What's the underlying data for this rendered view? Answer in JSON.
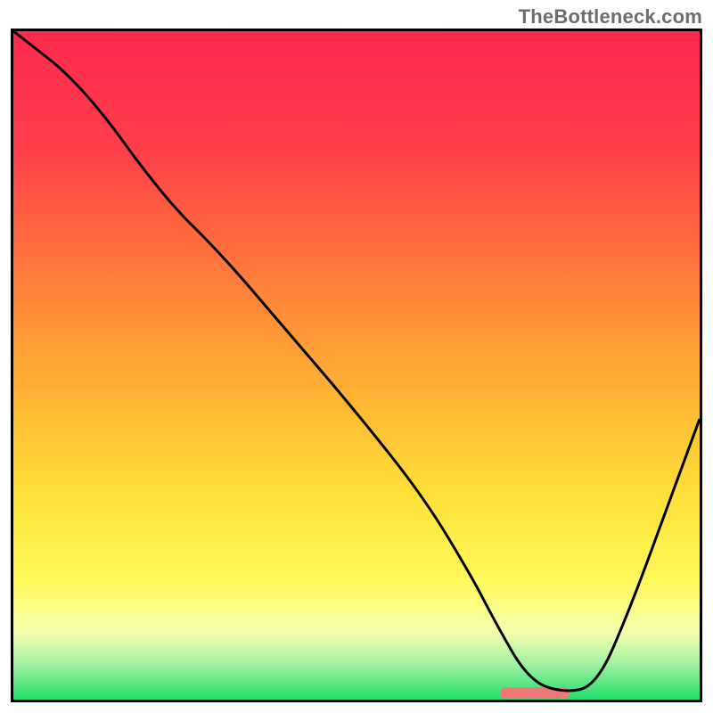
{
  "watermark": "TheBottleneck.com",
  "chart_data": {
    "type": "line",
    "title": "",
    "xlabel": "",
    "ylabel": "",
    "xlim": [
      0,
      100
    ],
    "ylim": [
      0,
      100
    ],
    "grid": false,
    "legend": false,
    "series": [
      {
        "name": "bottleneck-curve",
        "x": [
          0,
          10,
          22,
          30,
          40,
          50,
          60,
          67,
          70,
          75,
          80,
          85,
          90,
          95,
          100
        ],
        "values": [
          100,
          92,
          75,
          67,
          55,
          43,
          30,
          18,
          12,
          3,
          1,
          2,
          14,
          28,
          42
        ]
      }
    ],
    "optimal_marker": {
      "x_start": 71,
      "x_end": 81,
      "color": "#f07878",
      "thickness_pct": 1.2
    },
    "gradient_stops": [
      {
        "pct": 0,
        "color": "#ff2a4f"
      },
      {
        "pct": 18,
        "color": "#ff3e4a"
      },
      {
        "pct": 36,
        "color": "#ff7a3a"
      },
      {
        "pct": 55,
        "color": "#ffb633"
      },
      {
        "pct": 70,
        "color": "#ffe23a"
      },
      {
        "pct": 82,
        "color": "#fff95a"
      },
      {
        "pct": 90,
        "color": "#f6ffb0"
      },
      {
        "pct": 95,
        "color": "#9af0a0"
      },
      {
        "pct": 100,
        "color": "#1fdf6a"
      }
    ],
    "frame_color": "#000000",
    "curve_color": "#000000"
  }
}
